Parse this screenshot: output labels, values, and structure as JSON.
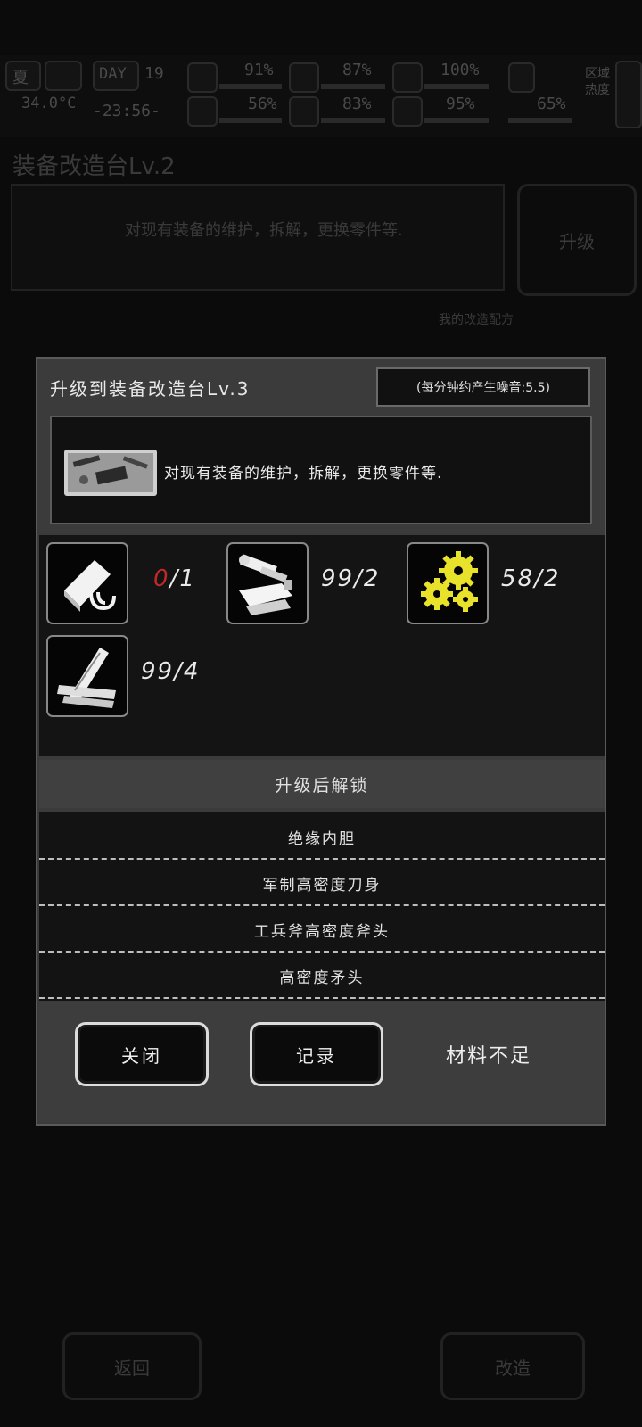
{
  "hud": {
    "season": "夏",
    "temperature": "34.0°C",
    "day_label": "DAY",
    "day_number": "19",
    "clock": "-23:56-",
    "area_heat_label": "区域热度",
    "stats": [
      {
        "name": "health",
        "value": "91%"
      },
      {
        "name": "stomach",
        "value": "87%"
      },
      {
        "name": "stamina",
        "value": "100%"
      },
      {
        "name": "mind",
        "value": "56%"
      },
      {
        "name": "water",
        "value": "83%"
      },
      {
        "name": "heart",
        "value": "95%"
      },
      {
        "name": "load",
        "value": "65%"
      }
    ]
  },
  "background": {
    "station_title": "装备改造台Lv.2",
    "station_desc": "对现有装备的维护，拆解，更换零件等.",
    "upgrade_label": "升级",
    "recipes_label": "我的改造配方",
    "back_label": "返回",
    "modify_label": "改造"
  },
  "modal": {
    "title": "升级到装备改造台Lv.3",
    "noise_note": "(每分钟约产生噪音:5.5)",
    "description": "对现有装备的维护，拆解，更换零件等.",
    "materials": [
      {
        "icon": "clip-icon",
        "have": "0",
        "sep": "/",
        "need": "1",
        "insufficient": true
      },
      {
        "icon": "parts-icon",
        "have": "99",
        "sep": "/",
        "need": "2",
        "insufficient": false
      },
      {
        "icon": "gears-icon",
        "have": "58",
        "sep": "/",
        "need": "2",
        "insufficient": false
      },
      {
        "icon": "planks-icon",
        "have": "99",
        "sep": "/",
        "need": "4",
        "insufficient": false
      }
    ],
    "unlock_header": "升级后解锁",
    "unlocks": [
      "绝缘内胆",
      "军制高密度刀身",
      "工兵斧高密度斧头",
      "高密度矛头"
    ],
    "close_label": "关闭",
    "record_label": "记录",
    "status_text": "材料不足"
  },
  "colors": {
    "insufficient": "#c0282a",
    "gear_yellow": "#e8e22a",
    "modal_bg": "#3b3b3b"
  }
}
